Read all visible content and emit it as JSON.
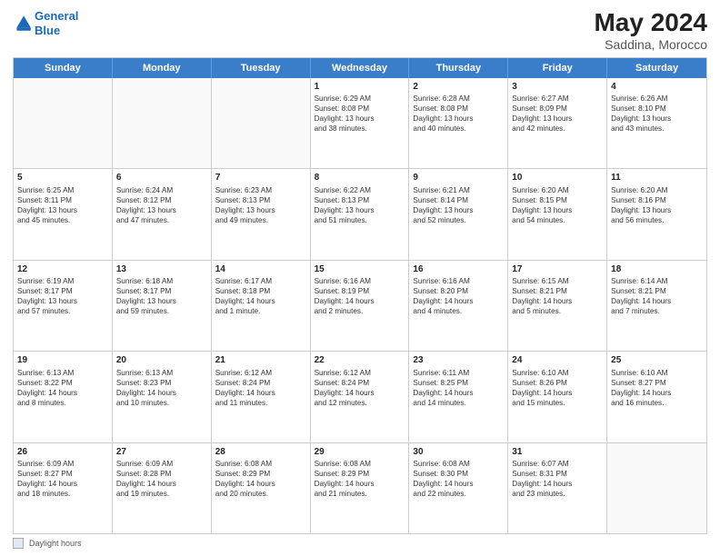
{
  "header": {
    "logo_line1": "General",
    "logo_line2": "Blue",
    "main_title": "May 2024",
    "subtitle": "Saddina, Morocco"
  },
  "footer": {
    "label": "Daylight hours"
  },
  "calendar": {
    "days_of_week": [
      "Sunday",
      "Monday",
      "Tuesday",
      "Wednesday",
      "Thursday",
      "Friday",
      "Saturday"
    ],
    "weeks": [
      [
        {
          "day": "",
          "empty": true
        },
        {
          "day": "",
          "empty": true
        },
        {
          "day": "",
          "empty": true
        },
        {
          "day": "1",
          "lines": [
            "Sunrise: 6:29 AM",
            "Sunset: 8:08 PM",
            "Daylight: 13 hours",
            "and 38 minutes."
          ]
        },
        {
          "day": "2",
          "lines": [
            "Sunrise: 6:28 AM",
            "Sunset: 8:08 PM",
            "Daylight: 13 hours",
            "and 40 minutes."
          ]
        },
        {
          "day": "3",
          "lines": [
            "Sunrise: 6:27 AM",
            "Sunset: 8:09 PM",
            "Daylight: 13 hours",
            "and 42 minutes."
          ]
        },
        {
          "day": "4",
          "lines": [
            "Sunrise: 6:26 AM",
            "Sunset: 8:10 PM",
            "Daylight: 13 hours",
            "and 43 minutes."
          ]
        }
      ],
      [
        {
          "day": "5",
          "lines": [
            "Sunrise: 6:25 AM",
            "Sunset: 8:11 PM",
            "Daylight: 13 hours",
            "and 45 minutes."
          ]
        },
        {
          "day": "6",
          "lines": [
            "Sunrise: 6:24 AM",
            "Sunset: 8:12 PM",
            "Daylight: 13 hours",
            "and 47 minutes."
          ]
        },
        {
          "day": "7",
          "lines": [
            "Sunrise: 6:23 AM",
            "Sunset: 8:13 PM",
            "Daylight: 13 hours",
            "and 49 minutes."
          ]
        },
        {
          "day": "8",
          "lines": [
            "Sunrise: 6:22 AM",
            "Sunset: 8:13 PM",
            "Daylight: 13 hours",
            "and 51 minutes."
          ]
        },
        {
          "day": "9",
          "lines": [
            "Sunrise: 6:21 AM",
            "Sunset: 8:14 PM",
            "Daylight: 13 hours",
            "and 52 minutes."
          ]
        },
        {
          "day": "10",
          "lines": [
            "Sunrise: 6:20 AM",
            "Sunset: 8:15 PM",
            "Daylight: 13 hours",
            "and 54 minutes."
          ]
        },
        {
          "day": "11",
          "lines": [
            "Sunrise: 6:20 AM",
            "Sunset: 8:16 PM",
            "Daylight: 13 hours",
            "and 56 minutes."
          ]
        }
      ],
      [
        {
          "day": "12",
          "lines": [
            "Sunrise: 6:19 AM",
            "Sunset: 8:17 PM",
            "Daylight: 13 hours",
            "and 57 minutes."
          ]
        },
        {
          "day": "13",
          "lines": [
            "Sunrise: 6:18 AM",
            "Sunset: 8:17 PM",
            "Daylight: 13 hours",
            "and 59 minutes."
          ]
        },
        {
          "day": "14",
          "lines": [
            "Sunrise: 6:17 AM",
            "Sunset: 8:18 PM",
            "Daylight: 14 hours",
            "and 1 minute."
          ]
        },
        {
          "day": "15",
          "lines": [
            "Sunrise: 6:16 AM",
            "Sunset: 8:19 PM",
            "Daylight: 14 hours",
            "and 2 minutes."
          ]
        },
        {
          "day": "16",
          "lines": [
            "Sunrise: 6:16 AM",
            "Sunset: 8:20 PM",
            "Daylight: 14 hours",
            "and 4 minutes."
          ]
        },
        {
          "day": "17",
          "lines": [
            "Sunrise: 6:15 AM",
            "Sunset: 8:21 PM",
            "Daylight: 14 hours",
            "and 5 minutes."
          ]
        },
        {
          "day": "18",
          "lines": [
            "Sunrise: 6:14 AM",
            "Sunset: 8:21 PM",
            "Daylight: 14 hours",
            "and 7 minutes."
          ]
        }
      ],
      [
        {
          "day": "19",
          "lines": [
            "Sunrise: 6:13 AM",
            "Sunset: 8:22 PM",
            "Daylight: 14 hours",
            "and 8 minutes."
          ]
        },
        {
          "day": "20",
          "lines": [
            "Sunrise: 6:13 AM",
            "Sunset: 8:23 PM",
            "Daylight: 14 hours",
            "and 10 minutes."
          ]
        },
        {
          "day": "21",
          "lines": [
            "Sunrise: 6:12 AM",
            "Sunset: 8:24 PM",
            "Daylight: 14 hours",
            "and 11 minutes."
          ]
        },
        {
          "day": "22",
          "lines": [
            "Sunrise: 6:12 AM",
            "Sunset: 8:24 PM",
            "Daylight: 14 hours",
            "and 12 minutes."
          ]
        },
        {
          "day": "23",
          "lines": [
            "Sunrise: 6:11 AM",
            "Sunset: 8:25 PM",
            "Daylight: 14 hours",
            "and 14 minutes."
          ]
        },
        {
          "day": "24",
          "lines": [
            "Sunrise: 6:10 AM",
            "Sunset: 8:26 PM",
            "Daylight: 14 hours",
            "and 15 minutes."
          ]
        },
        {
          "day": "25",
          "lines": [
            "Sunrise: 6:10 AM",
            "Sunset: 8:27 PM",
            "Daylight: 14 hours",
            "and 16 minutes."
          ]
        }
      ],
      [
        {
          "day": "26",
          "lines": [
            "Sunrise: 6:09 AM",
            "Sunset: 8:27 PM",
            "Daylight: 14 hours",
            "and 18 minutes."
          ]
        },
        {
          "day": "27",
          "lines": [
            "Sunrise: 6:09 AM",
            "Sunset: 8:28 PM",
            "Daylight: 14 hours",
            "and 19 minutes."
          ]
        },
        {
          "day": "28",
          "lines": [
            "Sunrise: 6:08 AM",
            "Sunset: 8:29 PM",
            "Daylight: 14 hours",
            "and 20 minutes."
          ]
        },
        {
          "day": "29",
          "lines": [
            "Sunrise: 6:08 AM",
            "Sunset: 8:29 PM",
            "Daylight: 14 hours",
            "and 21 minutes."
          ]
        },
        {
          "day": "30",
          "lines": [
            "Sunrise: 6:08 AM",
            "Sunset: 8:30 PM",
            "Daylight: 14 hours",
            "and 22 minutes."
          ]
        },
        {
          "day": "31",
          "lines": [
            "Sunrise: 6:07 AM",
            "Sunset: 8:31 PM",
            "Daylight: 14 hours",
            "and 23 minutes."
          ]
        },
        {
          "day": "",
          "empty": true
        }
      ]
    ]
  }
}
